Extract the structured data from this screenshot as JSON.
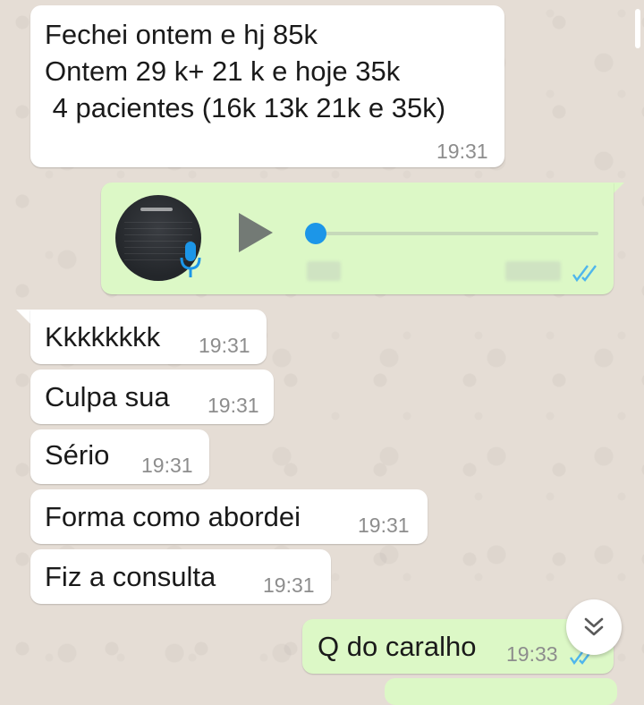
{
  "chat": {
    "messages": [
      {
        "direction": "in",
        "lines": [
          "Fechei ontem e hj 85k",
          "Ontem 29 k+ 21 k e hoje 35k",
          " 4 pacientes (16k 13k 21k e 35k)"
        ],
        "time": "19:31"
      },
      {
        "direction": "out",
        "type": "voice-note",
        "read_status": "read"
      },
      {
        "direction": "in",
        "text": "Kkkkkkkk",
        "time": "19:31"
      },
      {
        "direction": "in",
        "text": "Culpa sua",
        "time": "19:31"
      },
      {
        "direction": "in",
        "text": "Sério",
        "time": "19:31"
      },
      {
        "direction": "in",
        "text": "Forma como abordei",
        "time": "19:31"
      },
      {
        "direction": "in",
        "text": "Fiz a consulta",
        "time": "19:31"
      },
      {
        "direction": "out",
        "text": "Q do caralho",
        "time": "19:33",
        "read_status": "read"
      }
    ]
  },
  "controls": {
    "scroll_to_bottom_icon": "chevron-double-down-icon"
  },
  "colors": {
    "background": "#e5ddd5",
    "incoming_bubble": "#ffffff",
    "outgoing_bubble": "#dcf8c6",
    "read_ticks": "#4fb6ec",
    "audio_accent": "#1c96e8"
  }
}
